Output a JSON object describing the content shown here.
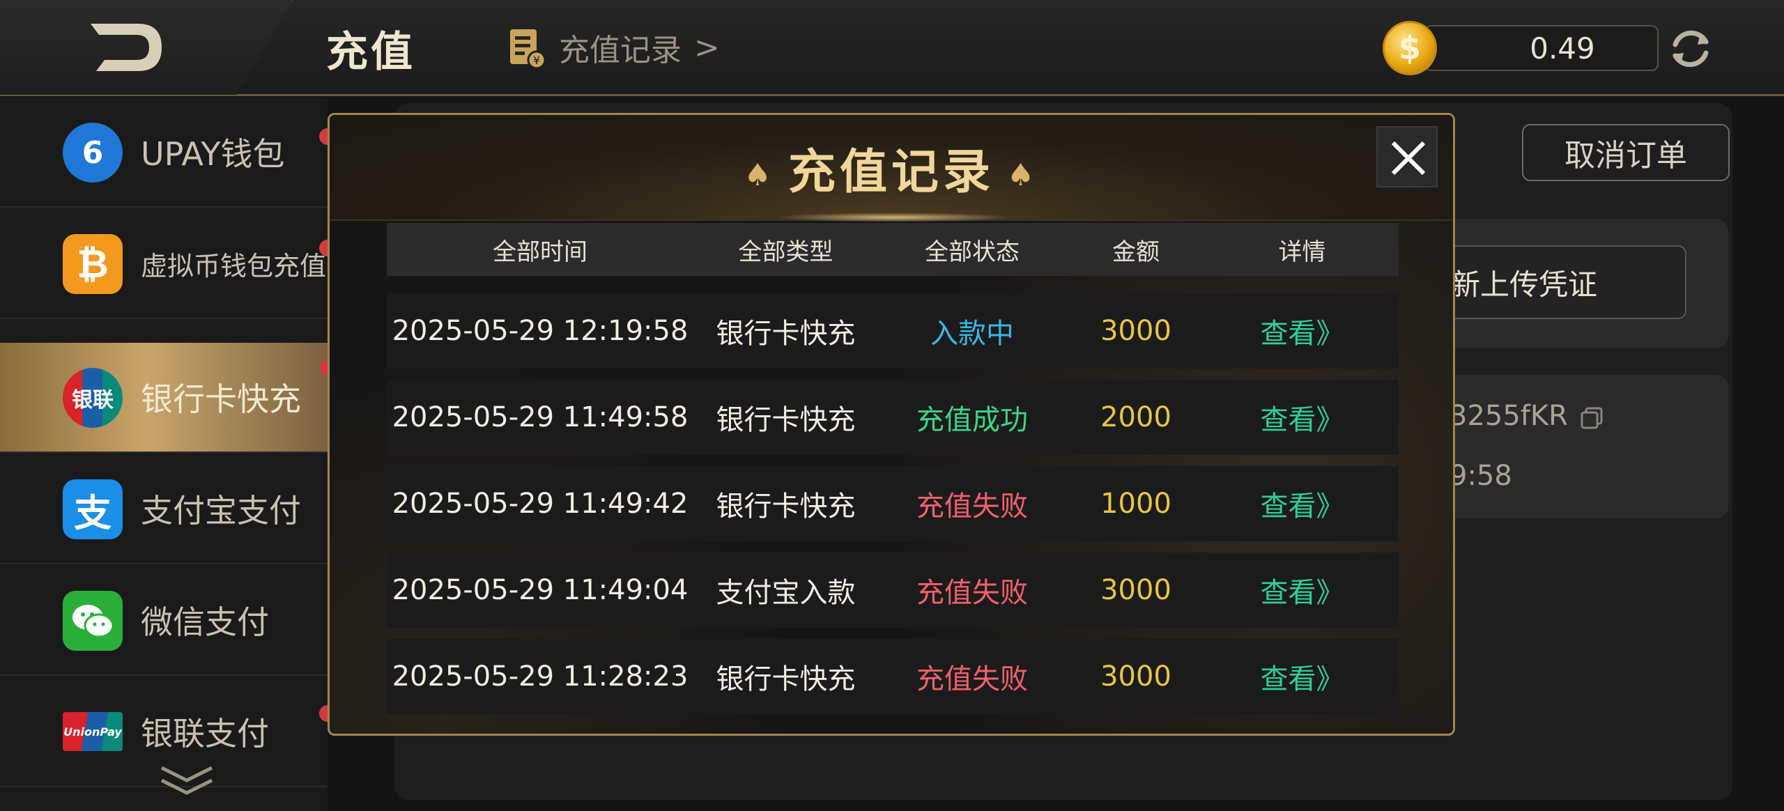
{
  "header": {
    "title": "充值",
    "record_link": "充值记录",
    "record_link_arrow": ">",
    "balance": "0.49",
    "coin_symbol": "$"
  },
  "sidebar": {
    "items": [
      {
        "label": "UPAY钱包",
        "icon": "upay-icon",
        "icon_text": "6"
      },
      {
        "label": "虚拟币钱包充值",
        "icon": "bitcoin-icon",
        "icon_text": "₿"
      },
      {
        "label": "银行卡快充",
        "icon": "unionpay-bank-icon",
        "icon_text": "银联",
        "active": true
      },
      {
        "label": "支付宝支付",
        "icon": "alipay-icon",
        "icon_text": "支"
      },
      {
        "label": "微信支付",
        "icon": "wechat-icon",
        "icon_text": ""
      },
      {
        "label": "银联支付",
        "icon": "unionpay-icon",
        "icon_text": "UnionPay"
      }
    ]
  },
  "background": {
    "cancel_order": "取消订单",
    "upload_proof": "新上传凭证",
    "order_no_partial": "3255fKR",
    "time_partial": "9:58"
  },
  "modal": {
    "title": "充值记录",
    "columns": [
      "全部时间",
      "全部类型",
      "全部状态",
      "金额",
      "详情"
    ],
    "rows": [
      {
        "time": "2025-05-29 12:19:58",
        "type": "银行卡快充",
        "status": "入款中",
        "status_kind": "pending",
        "amount": "3000",
        "detail": "查看》"
      },
      {
        "time": "2025-05-29 11:49:58",
        "type": "银行卡快充",
        "status": "充值成功",
        "status_kind": "ok",
        "amount": "2000",
        "detail": "查看》"
      },
      {
        "time": "2025-05-29 11:49:42",
        "type": "银行卡快充",
        "status": "充值失败",
        "status_kind": "fail",
        "amount": "1000",
        "detail": "查看》"
      },
      {
        "time": "2025-05-29 11:49:04",
        "type": "支付宝入款",
        "status": "充值失败",
        "status_kind": "fail",
        "amount": "3000",
        "detail": "查看》"
      },
      {
        "time": "2025-05-29 11:28:23",
        "type": "银行卡快充",
        "status": "充值失败",
        "status_kind": "fail",
        "amount": "3000",
        "detail": "查看》"
      }
    ]
  },
  "colors": {
    "accent_gold": "#d8b46a",
    "status_pending": "#3ab7e6",
    "status_ok": "#3ed48a",
    "status_fail": "#f0616b",
    "amount": "#e9c545",
    "view_link": "#2fcf9a"
  }
}
